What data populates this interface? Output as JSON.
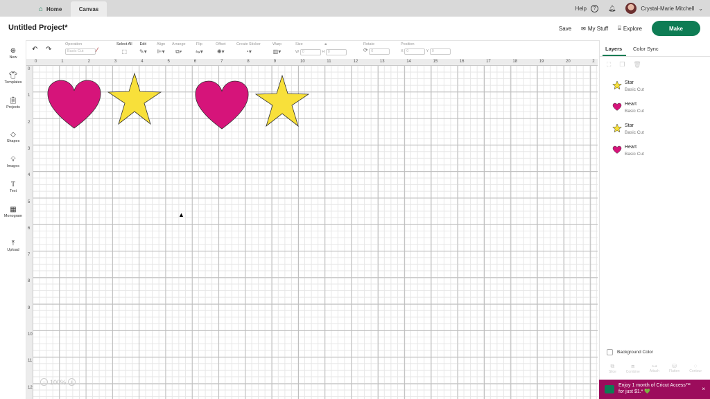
{
  "topbar": {
    "tabs": [
      {
        "label": "Home"
      },
      {
        "label": "Canvas"
      }
    ],
    "help": "Help",
    "help_icon": "?",
    "user": "Crystal-Marie Mitchell"
  },
  "header": {
    "title": "Untitled Project*",
    "save": "Save",
    "my_stuff": "My Stuff",
    "explore": "Explore",
    "make": "Make"
  },
  "toolbar": {
    "operation_label": "Operation",
    "operation_value": "Basic Cut",
    "select_all": "Select All",
    "edit": "Edit",
    "align": "Align",
    "arrange": "Arrange",
    "flip": "Flip",
    "offset": "Offset",
    "create_sticker": "Create Sticker",
    "warp": "Warp",
    "size": "Size",
    "w": "W",
    "w_value": "0",
    "h": "H",
    "h_value": "0",
    "rotate": "Rotate",
    "rotate_value": "0",
    "position": "Position",
    "x": "X",
    "x_value": "0",
    "y": "Y",
    "y_value": "0"
  },
  "leftnav": [
    {
      "label": "New",
      "icon": "plus-icon"
    },
    {
      "label": "Templates",
      "icon": "shirt-icon"
    },
    {
      "label": "Projects",
      "icon": "clipboard-icon"
    },
    {
      "label": "Shapes",
      "icon": "shapes-icon"
    },
    {
      "label": "Images",
      "icon": "bulb-icon"
    },
    {
      "label": "Text",
      "icon": "text-icon"
    },
    {
      "label": "Monogram",
      "icon": "monogram-icon"
    },
    {
      "label": "Upload",
      "icon": "upload-icon"
    }
  ],
  "ruler": {
    "top": [
      "0",
      "1",
      "2",
      "3",
      "4",
      "5",
      "6",
      "7",
      "8",
      "9",
      "10",
      "11",
      "12",
      "13",
      "14",
      "15",
      "16",
      "17",
      "18",
      "19",
      "20",
      "2"
    ],
    "left": [
      "0",
      "1",
      "2",
      "3",
      "4",
      "5",
      "6",
      "7",
      "8",
      "9",
      "10",
      "11",
      "12"
    ]
  },
  "canvas_shapes": [
    {
      "type": "heart",
      "color": "#d6147a"
    },
    {
      "type": "star",
      "color": "#f8e03a"
    },
    {
      "type": "heart",
      "color": "#d6147a"
    },
    {
      "type": "star",
      "color": "#f8e03a"
    }
  ],
  "zoom": {
    "minus": "−",
    "value": "100%",
    "plus": "+"
  },
  "panel": {
    "tabs": {
      "layers": "Layers",
      "color_sync": "Color Sync"
    },
    "layers": [
      {
        "name": "Star",
        "op": "Basic Cut",
        "icon": "star",
        "color": "#f8e03a"
      },
      {
        "name": "Heart",
        "op": "Basic Cut",
        "icon": "heart",
        "color": "#d6147a"
      },
      {
        "name": "Star",
        "op": "Basic Cut",
        "icon": "star",
        "color": "#f8e03a"
      },
      {
        "name": "Heart",
        "op": "Basic Cut",
        "icon": "heart",
        "color": "#d6147a"
      }
    ],
    "background_color": "Background Color",
    "footer": [
      "Slice",
      "Combine",
      "Attach",
      "Flatten",
      "Contour"
    ]
  },
  "promo": {
    "line1": "Enjoy 1 month of Cricut Access™",
    "line2": "for just $1.* 💚",
    "close": "×"
  },
  "colors": {
    "accent": "#0e7c54",
    "heart": "#d6147a",
    "star": "#f8e03a",
    "promo_bg": "#9c0c5c"
  }
}
